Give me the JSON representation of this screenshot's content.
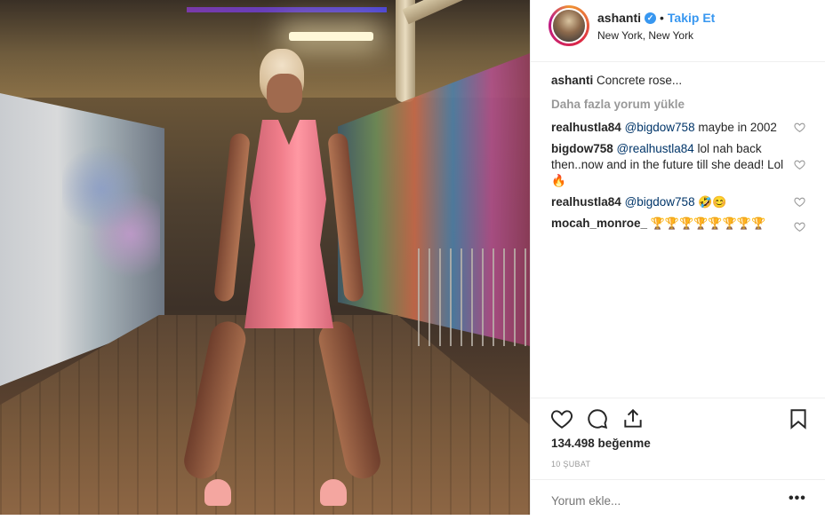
{
  "post": {
    "username": "ashanti",
    "follow_label": "Takip Et",
    "separator": "•",
    "location": "New York, New York",
    "caption_user": "ashanti",
    "caption": "Concrete rose..."
  },
  "load_more": "Daha fazla yorum yükle",
  "comments": [
    {
      "user": "realhustla84",
      "mention": "@bigdow758",
      "text": " maybe in 2002"
    },
    {
      "user": "bigdow758",
      "mention": "@realhustla84",
      "text": " lol nah back then..now and in the future till she dead! Lol 🔥"
    },
    {
      "user": "realhustla84",
      "mention": "@bigdow758",
      "text": " 🤣😊"
    },
    {
      "user": "mocah_monroe_",
      "mention": "",
      "text": " 🏆🏆🏆🏆🏆🏆🏆🏆"
    }
  ],
  "likes": "134.498 beğenme",
  "date": "10 ŞUBAT",
  "add_comment_placeholder": "Yorum ekle...",
  "more_icon": "•••",
  "colors": {
    "accent": "#3897f0",
    "text": "#262626",
    "muted": "#999999",
    "mention": "#003569"
  },
  "icons": [
    "verified-icon",
    "heart-icon",
    "comment-icon",
    "share-icon",
    "bookmark-icon",
    "more-icon"
  ]
}
